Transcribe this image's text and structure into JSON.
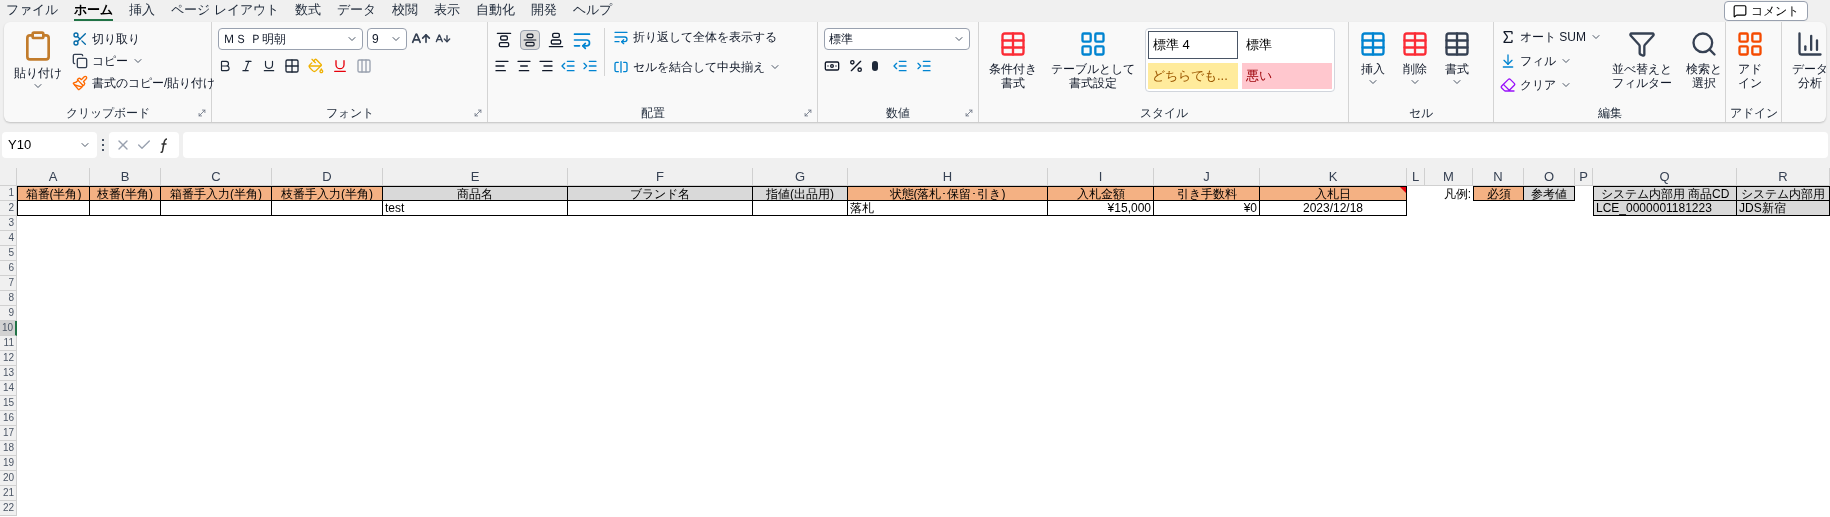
{
  "menu_tabs": [
    {
      "label": "ファイル",
      "selected": false
    },
    {
      "label": "ホーム",
      "selected": true
    },
    {
      "label": "挿入",
      "selected": false
    },
    {
      "label": "ページ レイアウト",
      "selected": false
    },
    {
      "label": "数式",
      "selected": false
    },
    {
      "label": "データ",
      "selected": false
    },
    {
      "label": "校閲",
      "selected": false
    },
    {
      "label": "表示",
      "selected": false
    },
    {
      "label": "自動化",
      "selected": false
    },
    {
      "label": "開発",
      "selected": false
    },
    {
      "label": "ヘルプ",
      "selected": false
    }
  ],
  "comment_button": "コメント",
  "clipboard": {
    "label": "クリップボード",
    "paste": [
      "貼り付け"
    ],
    "cut": "切り取り",
    "copy": "コピー",
    "format_painter": "書式のコピー/貼り付け"
  },
  "font": {
    "label": "フォント",
    "font_name": "ＭＳ Ｐ明朝",
    "font_size": "9"
  },
  "alignment": {
    "label": "配置",
    "wrap": "折り返して全体を表示する",
    "merge": "セルを結合して中央揃え",
    "vertical": [
      {
        "kind": "top",
        "selected": false
      },
      {
        "kind": "middle",
        "selected": true
      },
      {
        "kind": "bottom",
        "selected": false
      }
    ]
  },
  "number": {
    "label": "数値",
    "format": "標準"
  },
  "styles": {
    "label": "スタイル",
    "conditional": [
      "条件付き",
      "書式"
    ],
    "table": [
      "テーブルとして",
      "書式設定"
    ],
    "cell_styles": [
      {
        "text": "標準 4",
        "kind": "normal",
        "selected": true
      },
      {
        "text": "標準",
        "kind": "normal",
        "selected": false
      },
      {
        "text": "どちらでも...",
        "kind": "neutral",
        "selected": false
      },
      {
        "text": "悪い",
        "kind": "bad",
        "selected": false
      }
    ]
  },
  "cells": {
    "label": "セル",
    "insert": [
      "挿入"
    ],
    "delete": [
      "削除"
    ],
    "format": [
      "書式"
    ]
  },
  "editing": {
    "label": "編集",
    "autosum": "オート SUM",
    "fill": "フィル",
    "clear": "クリア",
    "sort": [
      "並べ替えと",
      "フィルター"
    ],
    "find": [
      "検索と",
      "選択"
    ]
  },
  "addin": {
    "label": "アドイン",
    "button": [
      "アド",
      "イン"
    ]
  },
  "analysis": {
    "button": [
      "データ",
      "分析"
    ]
  },
  "formula_bar": {
    "name_box": "Y10"
  },
  "sheet": {
    "columns": [
      "A",
      "B",
      "C",
      "D",
      "E",
      "F",
      "G",
      "H",
      "I",
      "J",
      "K",
      "L",
      "M",
      "N",
      "O",
      "P",
      "Q",
      "R"
    ],
    "rows": [
      {
        "label": "1",
        "selected": false,
        "cells": [
          {
            "text": "箱番(半角)",
            "color": "#f4b183",
            "kind": "header"
          },
          {
            "text": "枝番(半角)",
            "color": "#f4b183",
            "kind": "header"
          },
          {
            "text": "箱番手入力(半角)",
            "color": "#f4b183",
            "kind": "header"
          },
          {
            "text": "枝番手入力(半角)",
            "color": "#f4b183",
            "kind": "header"
          },
          {
            "text": "商品名",
            "color": "#d9d9d9",
            "kind": "header"
          },
          {
            "text": "ブランド名",
            "color": "#d9d9d9",
            "kind": "header"
          },
          {
            "text": "指値(出品用)",
            "color": "#d9d9d9",
            "kind": "header"
          },
          {
            "text": "状態(落札･保留･引き)",
            "color": "#f4b183",
            "kind": "header"
          },
          {
            "text": "入札金額",
            "color": "#f4b183",
            "kind": "header"
          },
          {
            "text": "引き手数料",
            "color": "#f4b183",
            "kind": "header"
          },
          {
            "text": "入札日",
            "color": "#f4b183",
            "kind": "header",
            "comment": true
          },
          {
            "kind": "blank"
          },
          {
            "text": "凡例:",
            "kind": "label"
          },
          {
            "text": "必須",
            "color": "#f4b183",
            "kind": "header"
          },
          {
            "text": "参考値",
            "color": "#d9d9d9",
            "kind": "header"
          },
          {
            "kind": "blank"
          },
          {
            "text": "システム内部用 商品CD",
            "color": "#d9d9d9",
            "kind": "header"
          },
          {
            "text": "システム内部用",
            "color": "#d9d9d9",
            "kind": "header"
          }
        ]
      },
      {
        "label": "2",
        "selected": false,
        "cells": [
          {
            "kind": "empty"
          },
          {
            "kind": "empty"
          },
          {
            "kind": "empty"
          },
          {
            "kind": "empty"
          },
          {
            "text": "test",
            "kind": "text"
          },
          {
            "kind": "empty"
          },
          {
            "kind": "empty"
          },
          {
            "text": "落札",
            "kind": "text"
          },
          {
            "text": "¥15,000",
            "kind": "number"
          },
          {
            "text": "¥0",
            "kind": "number"
          },
          {
            "text": "2023/12/18",
            "kind": "date"
          },
          {
            "kind": "blank"
          },
          {
            "kind": "blank"
          },
          {
            "kind": "blank"
          },
          {
            "kind": "blank"
          },
          {
            "kind": "blank"
          },
          {
            "text": "LCE_0000001181223",
            "color": "#d9d9d9",
            "kind": "text"
          },
          {
            "text": "JDS新宿",
            "color": "#d9d9d9",
            "kind": "text"
          }
        ]
      },
      {
        "label": "3",
        "selected": false
      },
      {
        "label": "4",
        "selected": false
      },
      {
        "label": "5",
        "selected": false
      },
      {
        "label": "6",
        "selected": false
      },
      {
        "label": "7",
        "selected": false
      },
      {
        "label": "8",
        "selected": false
      },
      {
        "label": "9",
        "selected": false
      },
      {
        "label": "10",
        "selected": true
      },
      {
        "label": "11",
        "selected": false
      },
      {
        "label": "12",
        "selected": false
      },
      {
        "label": "13",
        "selected": false
      },
      {
        "label": "14",
        "selected": false
      },
      {
        "label": "15",
        "selected": false
      },
      {
        "label": "16",
        "selected": false
      },
      {
        "label": "17",
        "selected": false
      },
      {
        "label": "18",
        "selected": false
      },
      {
        "label": "19",
        "selected": false
      },
      {
        "label": "20",
        "selected": false
      },
      {
        "label": "21",
        "selected": false
      },
      {
        "label": "22",
        "selected": false
      }
    ]
  }
}
